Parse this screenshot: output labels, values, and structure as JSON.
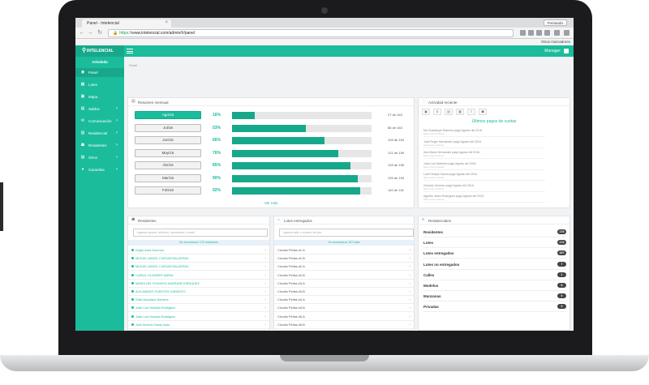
{
  "browser": {
    "tab_title": "Panel - Intelencial",
    "tab_close": "×",
    "user": "Fernando",
    "url_scheme": "https://",
    "url_rest": "www.intelencial.com/admin/#/panel",
    "other_bookmarks": "Otros marcadores"
  },
  "header": {
    "brand": "INTELENCIAL",
    "manager": "Manager"
  },
  "sidebar": {
    "user": "Arboleda",
    "items": [
      {
        "label": "Panel",
        "icon": "dashboard-icon",
        "glyph": "◉"
      },
      {
        "label": "Lotes",
        "icon": "map-icon",
        "glyph": "▦"
      },
      {
        "label": "Mapa",
        "icon": "image-icon",
        "glyph": "▣"
      },
      {
        "label": "Saldos",
        "icon": "wallet-icon",
        "glyph": "▤",
        "chevron": "›"
      },
      {
        "label": "Comunicación",
        "icon": "chat-icon",
        "glyph": "✉",
        "chevron": "›"
      },
      {
        "label": "Residencial",
        "icon": "building-icon",
        "glyph": "▥",
        "chevron": "›"
      },
      {
        "label": "Residentes",
        "icon": "users-icon",
        "glyph": "☗",
        "chevron": "›"
      },
      {
        "label": "Otros",
        "icon": "folder-icon",
        "glyph": "▤",
        "chevron": "›"
      },
      {
        "label": "Garantías",
        "icon": "shield-icon",
        "glyph": "♦",
        "chevron": "›"
      }
    ]
  },
  "breadcrumb": "Panel",
  "monthly": {
    "title": "Resumen mensual",
    "rows": [
      {
        "month": "Ago/16",
        "pct": "16%",
        "value": 0.16,
        "count": "27 de 163",
        "active": true
      },
      {
        "month": "Jul/16",
        "pct": "53%",
        "value": 0.53,
        "count": "86 de 163"
      },
      {
        "month": "Jun/16",
        "pct": "66%",
        "value": 0.66,
        "count": "109 de 163"
      },
      {
        "month": "May/16",
        "pct": "76%",
        "value": 0.76,
        "count": "121 de 159"
      },
      {
        "month": "Abr/16",
        "pct": "85%",
        "value": 0.85,
        "count": "133 de 155"
      },
      {
        "month": "Mar/16",
        "pct": "90%",
        "value": 0.9,
        "count": "139 de 153"
      },
      {
        "month": "Feb/16",
        "pct": "92%",
        "value": 0.92,
        "count": "140 de 151"
      }
    ],
    "more": "Ver más"
  },
  "activity": {
    "title": "Actividad reciente",
    "subtitle": "Últimos pagos de cuotas",
    "items": [
      {
        "text": "Ma Guadalupe Ramírez pagó Agosto del 2016.",
        "sub": "hace unos minutos"
      },
      {
        "text": "José Roger Hernández pagó Agosto del 2016.",
        "sub": "hace unos minutos"
      },
      {
        "text": "Ana María Hernández pagó Agosto del 2016.",
        "sub": "hace unos minutos"
      },
      {
        "text": "Juan Luis Martínez pagó Agosto del 2016.",
        "sub": "hace unos minutos"
      },
      {
        "text": "Luis Enrique García pagó Agosto del 2016.",
        "sub": "hace unos minutos"
      },
      {
        "text": "Gerardo Jiménez pagó Agosto del 2016.",
        "sub": "hace unos minutos"
      },
      {
        "text": "Agustín Jesús Rodríguez pagó Agosto del 2016.",
        "sub": "hace unos minutos"
      }
    ]
  },
  "residents": {
    "title": "Residentes",
    "placeholder": "Ingresa nombre, teléfono, comentario o email.",
    "found": "Se encontraron 176 residentes",
    "rows": [
      "Edgar Avila Guerrero",
      "MIGUEL ANGEL CUEVAS BALDERAS",
      "MIGUEL ANGEL CUEVAS BALDERAS",
      "CURIAL OLIVARES MARIA",
      "MARIA DEL ROSARIO ANDRADE ENRIQUEZ",
      "ALEJANDRO FUENTES GARAVITO",
      "Edith Alcantara Ramirez",
      "Juan Luis Hurtado Rodriguez",
      "Juan Luis Hurtado Rodriguez",
      "José Antonio Garay Islas"
    ]
  },
  "lots": {
    "title": "Lotes entregados",
    "placeholder": "Ingresa calle o número de lote.",
    "found": "Se encontraron 167 lotes",
    "rows": [
      "Circuito Peñas #1-A",
      "Circuito Peñas #1-B",
      "Circuito Peñas #2-A",
      "Circuito Peñas #2-B",
      "Circuito Peñas #3-A",
      "Circuito Peñas #3-B",
      "Circuito Peñas #4-A",
      "Circuito Peñas #4-B",
      "Circuito Peñas #5-A",
      "Circuito Peñas #5-B"
    ]
  },
  "summary": {
    "title": "Residenciales",
    "rows": [
      {
        "label": "Residentes",
        "count": "176"
      },
      {
        "label": "Lotes",
        "count": "174"
      },
      {
        "label": "Lotes entregados",
        "count": "167"
      },
      {
        "label": "Lotes no entregados",
        "count": "7"
      },
      {
        "label": "Calles",
        "count": "1"
      },
      {
        "label": "Modelos",
        "count": "6"
      },
      {
        "label": "Manzanas",
        "count": "0"
      },
      {
        "label": "Privadas",
        "count": "0"
      }
    ]
  },
  "colors": {
    "accent": "#1abc9c",
    "accent_dark": "#17a88b"
  }
}
